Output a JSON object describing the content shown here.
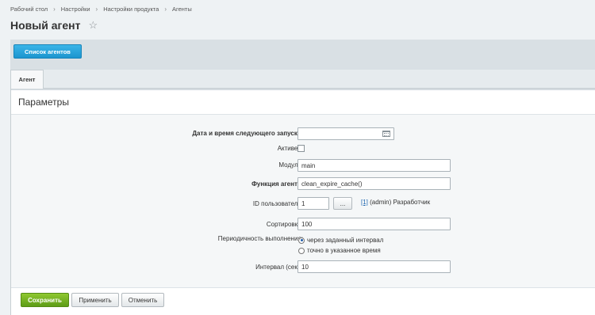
{
  "breadcrumb": [
    "Рабочий стол",
    "Настройки",
    "Настройки продукта",
    "Агенты"
  ],
  "breadcrumb_separator": "›",
  "page": {
    "title": "Новый агент",
    "favorite_icon": "star-icon"
  },
  "toolbar": {
    "agents_list_label": "Список агентов"
  },
  "tabs": [
    {
      "label": "Агент"
    }
  ],
  "section": {
    "title": "Параметры"
  },
  "form": {
    "next_run": {
      "label": "Дата и время следующего запуска:",
      "value": ""
    },
    "active": {
      "label": "Активен:",
      "checked": false
    },
    "module": {
      "label": "Модуль:",
      "value": "main"
    },
    "function": {
      "label": "Функция агента:",
      "value": "clean_expire_cache()"
    },
    "user_id": {
      "label": "ID пользователя:",
      "value": "1",
      "pick_label": "...",
      "user_link": "[1]",
      "user_name": "(admin) Разработчик"
    },
    "sort": {
      "label": "Сортировка:",
      "value": "100"
    },
    "periodicity": {
      "label": "Периодичность выполнения:",
      "options": [
        "через заданный интервал",
        "точно в указанное время"
      ],
      "selected": 0
    },
    "interval": {
      "label": "Интервал (сек.):",
      "value": "10"
    }
  },
  "buttons": {
    "save": "Сохранить",
    "apply": "Применить",
    "cancel": "Отменить"
  }
}
